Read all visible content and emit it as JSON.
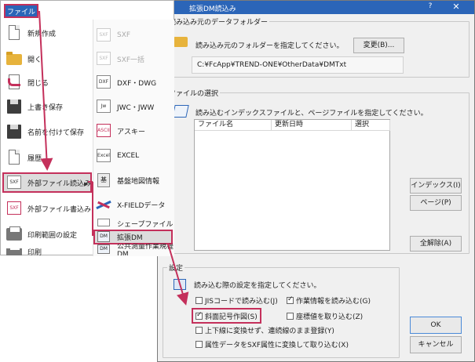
{
  "dialog": {
    "title": "拡張DM読込み",
    "help_button": "?",
    "close_button": "✕",
    "source_group": {
      "legend": "読み込み元のデータフォルダー",
      "description": "読み込み元のフォルダーを指定してください。",
      "change_button": "変更(B)...",
      "path": "C:¥FcApp¥TREND-ONE¥OtherData¥DMTxt"
    },
    "file_group": {
      "legend": "ファイルの選択",
      "description": "読み込むインデックスファイルと、ページファイルを指定してください。",
      "columns": [
        "ファイル名",
        "更新日時",
        "選択"
      ],
      "index_button": "インデックス(I)",
      "page_button": "ページ(P)",
      "clear_button": "全解除(A)"
    },
    "settings_group": {
      "legend": "設定",
      "description": "読み込む際の設定を指定してください。",
      "options": [
        {
          "label": "JISコードで読み込む(J)",
          "checked": false
        },
        {
          "label": "作業情報を読み込む(G)",
          "checked": true
        },
        {
          "label": "斜面記号作図(S)",
          "checked": true
        },
        {
          "label": "座標値を取り込む(Z)",
          "checked": false
        },
        {
          "label": "上下線に変換せず、連続線のまま登録(Y)",
          "checked": false
        },
        {
          "label": "属性データをSXF属性に変換して取り込む(X)",
          "checked": false
        }
      ]
    },
    "ok_button": "OK",
    "cancel_button": "キャンセル"
  },
  "menu": {
    "tab_label": "ファイル",
    "left_items": [
      {
        "label": "新規作成",
        "icon": "new-document-icon"
      },
      {
        "label": "開く",
        "icon": "folder-icon"
      },
      {
        "label": "閉じる",
        "icon": "close-document-icon"
      },
      {
        "label": "上書き保存",
        "icon": "save-icon"
      },
      {
        "label": "名前を付けて保存",
        "icon": "save-as-icon"
      },
      {
        "label": "履歴",
        "icon": "history-icon"
      },
      {
        "label": "外部ファイル読込み",
        "icon": "import-icon"
      },
      {
        "label": "外部ファイル書込み",
        "icon": "export-icon"
      },
      {
        "label": "印刷範囲の設定",
        "icon": "print-icon"
      },
      {
        "label": "印刷",
        "icon": "print-icon"
      }
    ],
    "right_items": [
      {
        "label": "SXF",
        "disabled": true,
        "icon": "sxf-icon"
      },
      {
        "label": "SXF一括",
        "disabled": true,
        "icon": "sxf-batch-icon"
      },
      {
        "label": "DXF・DWG",
        "disabled": false,
        "icon": "dxf-icon"
      },
      {
        "label": "JWC・JWW",
        "disabled": false,
        "icon": "jw-icon"
      },
      {
        "label": "アスキー",
        "disabled": false,
        "icon": "ascii-icon"
      },
      {
        "label": "EXCEL",
        "disabled": false,
        "icon": "excel-icon"
      },
      {
        "label": "基盤地図情報",
        "disabled": false,
        "icon": "map-icon"
      },
      {
        "label": "X-FIELDデータ",
        "disabled": false,
        "icon": "xfield-icon"
      },
      {
        "label": "シェープファイル",
        "disabled": false,
        "icon": "shape-icon"
      },
      {
        "label": "拡張DM",
        "disabled": false,
        "icon": "dm-icon"
      },
      {
        "label": "公共測量作業規程DM",
        "disabled": false,
        "icon": "dm-icon"
      }
    ],
    "icon_texts": {
      "sxf": "SXF",
      "dxf": "DXF",
      "jw": "Jw",
      "ascii": "ASCII",
      "excel": "Excel",
      "map": "基",
      "dm": "DM"
    }
  },
  "colors": {
    "accent": "#2b65b8",
    "highlight": "#c4305b"
  }
}
